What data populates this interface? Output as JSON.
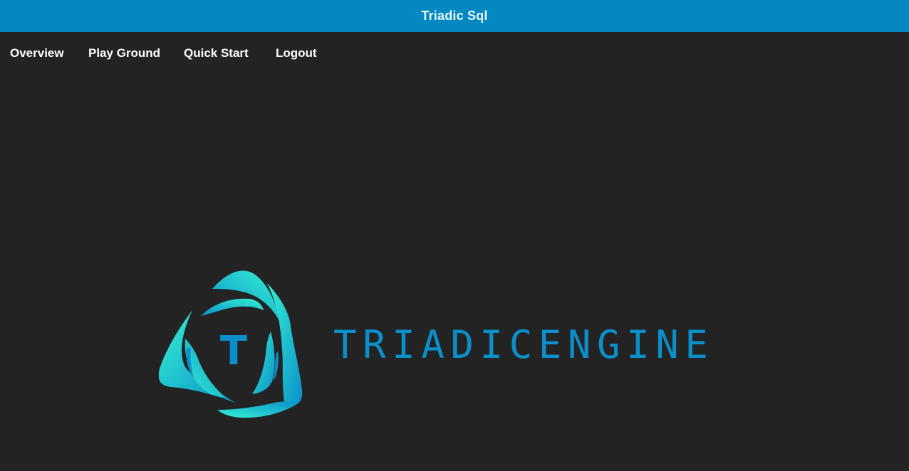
{
  "app": {
    "title": "Triadic Sql"
  },
  "nav": {
    "items": [
      {
        "label": "Overview"
      },
      {
        "label": "Play Ground"
      },
      {
        "label": "Quick Start"
      },
      {
        "label": "Logout"
      }
    ]
  },
  "logo": {
    "icon": "triadic-triangle-logo-icon",
    "letter": "T",
    "wordmark": "TRIADICENGINE"
  },
  "colors": {
    "titlebar": "#0388c2",
    "background": "#232323",
    "accent": "#0a8fca",
    "logo_gradient_start": "#2ef0d4",
    "logo_gradient_end": "#0a8fca"
  }
}
